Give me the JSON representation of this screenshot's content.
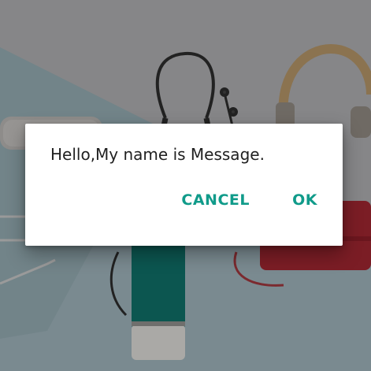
{
  "dialog": {
    "message": "Hello,My name is Message.",
    "buttons": {
      "negative_label": "CANCEL",
      "positive_label": "OK"
    },
    "accent_color": "#109b8a",
    "text_color": "#212121",
    "background_color": "#ffffff"
  },
  "background": {
    "description_icons": [
      "headphones",
      "earphones",
      "speaker",
      "bluetooth-speaker",
      "cable",
      "red-case"
    ],
    "scrim_color": "#000000"
  }
}
